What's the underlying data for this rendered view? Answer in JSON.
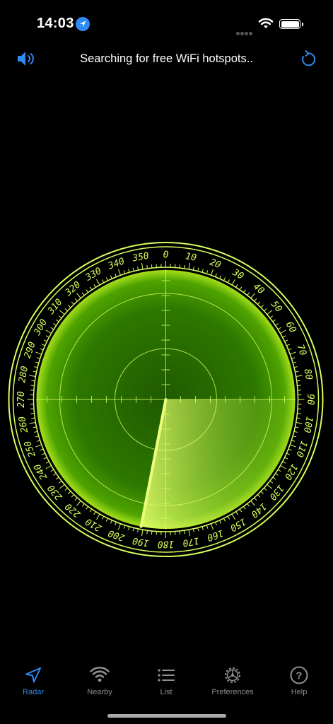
{
  "status": {
    "time": "14:03"
  },
  "nav": {
    "title": "Searching for free WiFi hotspots.."
  },
  "radar": {
    "heading_labels": [
      "0",
      "10",
      "20",
      "30",
      "40",
      "50",
      "60",
      "70",
      "80",
      "90",
      "100",
      "110",
      "120",
      "130",
      "140",
      "150",
      "160",
      "170",
      "180",
      "190",
      "200",
      "210",
      "220",
      "230",
      "240",
      "250",
      "260",
      "270",
      "280",
      "290",
      "300",
      "310",
      "320",
      "330",
      "340",
      "350"
    ]
  },
  "tabs": [
    {
      "label": "Radar",
      "icon": "navigation-arrow-icon"
    },
    {
      "label": "Nearby",
      "icon": "wifi-icon"
    },
    {
      "label": "List",
      "icon": "list-icon"
    },
    {
      "label": "Preferences",
      "icon": "gear-icon"
    },
    {
      "label": "Help",
      "icon": "question-icon"
    }
  ],
  "colors": {
    "accent": "#2f8bf3",
    "radar_line": "#d6ff5e",
    "radar_green": "#2f7a00"
  }
}
